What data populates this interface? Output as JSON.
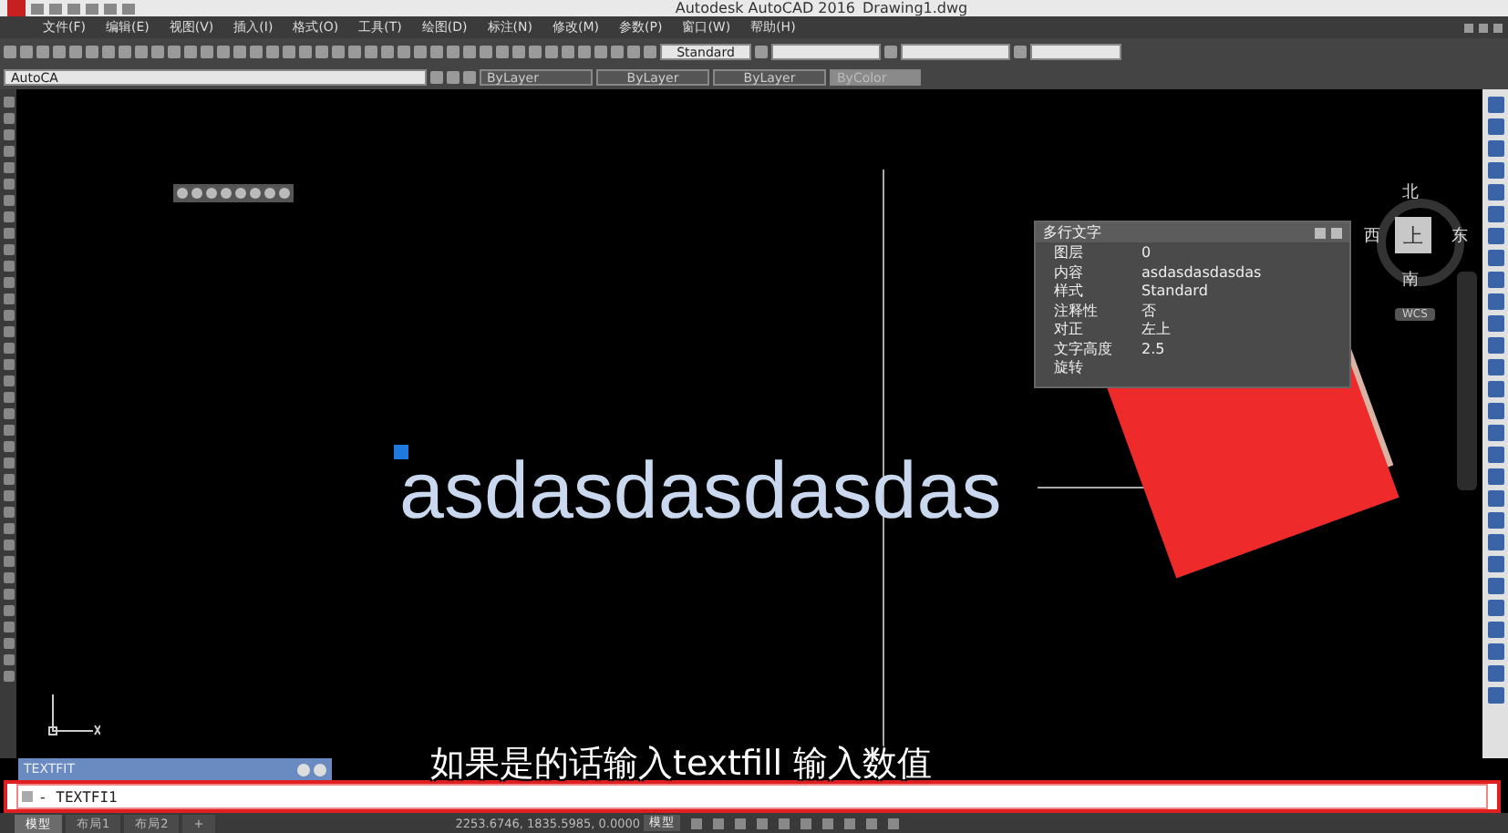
{
  "window": {
    "title": "Autodesk AutoCAD 2016",
    "file": "Drawing1.dwg"
  },
  "menu": [
    "文件(F)",
    "编辑(E)",
    "视图(V)",
    "插入(I)",
    "格式(O)",
    "工具(T)",
    "绘图(D)",
    "标注(N)",
    "修改(M)",
    "参数(P)",
    "窗口(W)",
    "帮助(H)"
  ],
  "toolbar": {
    "text_style": "Standard",
    "workspace": "AutoCA",
    "layer": "ByLayer",
    "linetype": "ByLayer",
    "lineweight": "ByLayer",
    "plot_style": "ByColor"
  },
  "viewcube": {
    "north": "北",
    "east": "东",
    "south": "南",
    "west": "西",
    "face": "上",
    "ucs": "WCS"
  },
  "properties": {
    "title": "多行文字",
    "rows": [
      {
        "label": "图层",
        "value": "0"
      },
      {
        "label": "内容",
        "value": "asdasdasdasdas"
      },
      {
        "label": "样式",
        "value": "Standard"
      },
      {
        "label": "注释性",
        "value": "否"
      },
      {
        "label": "对正",
        "value": "左上"
      },
      {
        "label": "文字高度",
        "value": "2.5"
      },
      {
        "label": "旋转",
        "value": ""
      }
    ]
  },
  "canvas_text": "asdasdasdasdas",
  "command": {
    "history": "TEXTFIT",
    "input": "- TEXTFI1"
  },
  "subtitle": "如果是的话输入textfill 输入数值",
  "tabs": [
    {
      "label": "模型",
      "selected": true
    },
    {
      "label": "布局1",
      "selected": false
    },
    {
      "label": "布局2",
      "selected": false
    },
    {
      "label": "+",
      "selected": false
    }
  ],
  "status": {
    "coords": "2253.6746, 1835.5985, 0.0000",
    "space": "模型"
  }
}
